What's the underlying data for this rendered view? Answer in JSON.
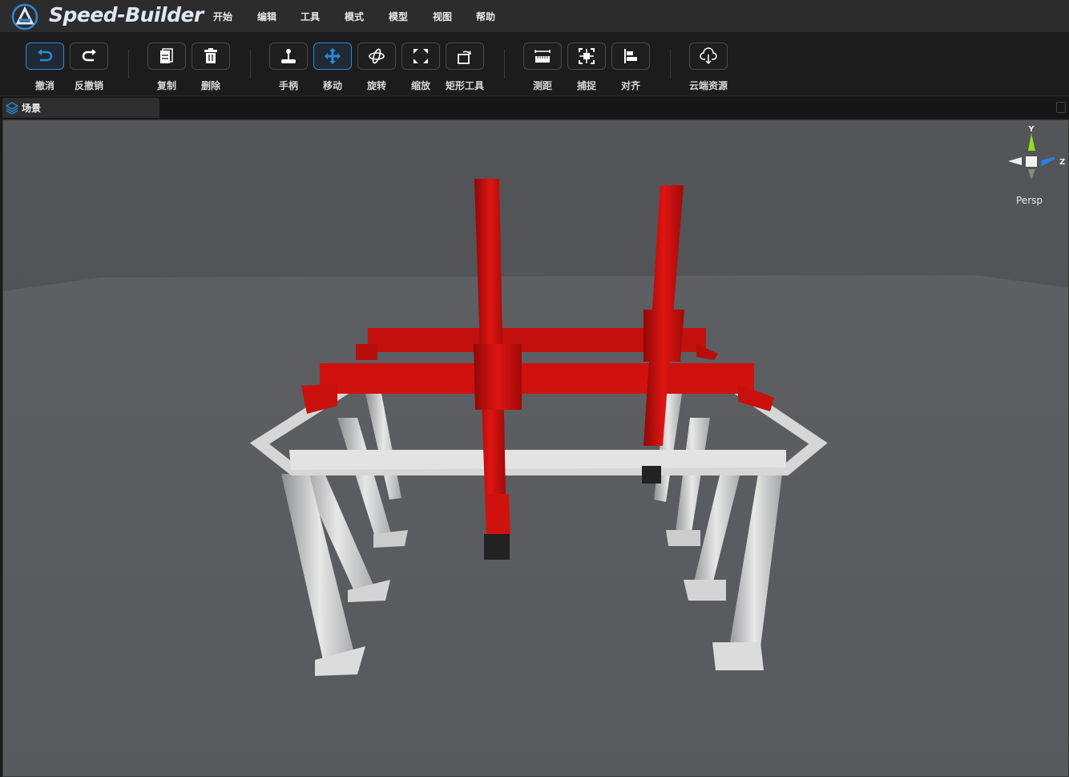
{
  "app": {
    "brand": "Speed-Builder"
  },
  "menu": [
    "开始",
    "编辑",
    "工具",
    "模式",
    "模型",
    "视图",
    "帮助"
  ],
  "toolbar": {
    "undo": "撤消",
    "redo": "反撤销",
    "copy": "复制",
    "delete": "删除",
    "handle": "手柄",
    "move": "移动",
    "rotate": "旋转",
    "scale": "缩放",
    "rect_tool": "矩形工具",
    "measure": "测距",
    "snap": "捕捉",
    "align": "对齐",
    "cloud": "云端资源"
  },
  "tabs": {
    "scene": "场景"
  },
  "gizmo": {
    "y": "Y",
    "z": "Z",
    "mode": "Persp"
  },
  "colors": {
    "accent": "#2b8ad8",
    "frame": "#d0d0d0",
    "gantry": "#c8100c"
  }
}
